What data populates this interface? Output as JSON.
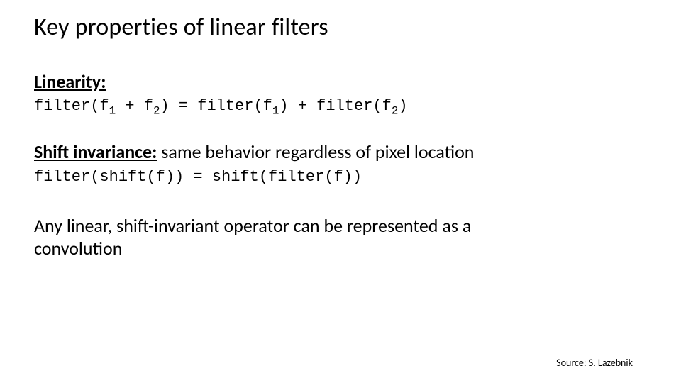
{
  "title": "Key properties of linear filters",
  "linearity": {
    "heading": "Linearity:",
    "code_html": "filter(f<sub>1</sub> + f<sub>2</sub>) = filter(f<sub>1</sub>) + filter(f<sub>2</sub>)"
  },
  "shift": {
    "heading": "Shift invariance:",
    "body": " same behavior regardless of pixel location",
    "code": "filter(shift(f)) = shift(filter(f))"
  },
  "conclusion": "Any linear, shift-invariant operator can be represented as a convolution",
  "source": "Source: S. Lazebnik"
}
